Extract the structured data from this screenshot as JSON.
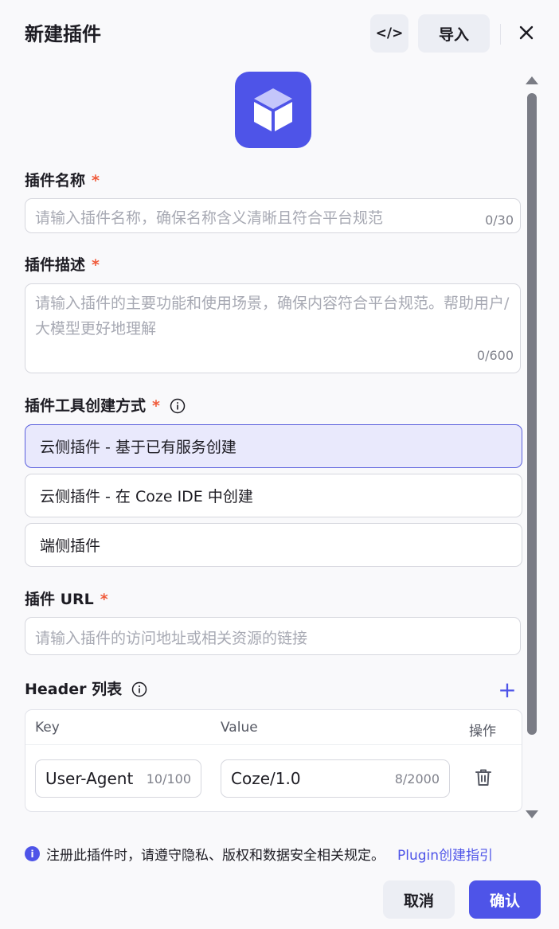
{
  "dialog": {
    "title": "新建插件",
    "code_icon_label": "</>",
    "import_label": "导入"
  },
  "form": {
    "name": {
      "label": "插件名称",
      "required_mark": "*",
      "placeholder": "请输入插件名称，确保名称含义清晰且符合平台规范",
      "count": "0/30"
    },
    "description": {
      "label": "插件描述",
      "required_mark": "*",
      "placeholder": "请输入插件的主要功能和使用场景，确保内容符合平台规范。帮助用户/大模型更好地理解",
      "count": "0/600"
    },
    "creation_method": {
      "label": "插件工具创建方式",
      "required_mark": "*",
      "options": [
        {
          "label": "云侧插件 - 基于已有服务创建",
          "selected": true
        },
        {
          "label": "云侧插件 - 在 Coze IDE 中创建",
          "selected": false
        },
        {
          "label": "端侧插件",
          "selected": false
        }
      ]
    },
    "url": {
      "label": "插件 URL",
      "required_mark": "*",
      "placeholder": "请输入插件的访问地址或相关资源的链接"
    },
    "headers": {
      "label": "Header 列表",
      "add_label": "+",
      "columns": {
        "key": "Key",
        "value": "Value",
        "action": "操作"
      },
      "rows": [
        {
          "key": "User-Agent",
          "key_count": "10/100",
          "value": "Coze/1.0",
          "value_count": "8/2000"
        }
      ]
    }
  },
  "footer": {
    "notice": "注册此插件时，请遵守隐私、版权和数据安全相关规定。",
    "notice_icon": "i",
    "guide_link": "Plugin创建指引",
    "cancel_label": "取消",
    "confirm_label": "确认"
  },
  "colors": {
    "accent": "#4e54e8",
    "required": "#f05b3b",
    "selected_bg": "#e9e9fc"
  }
}
